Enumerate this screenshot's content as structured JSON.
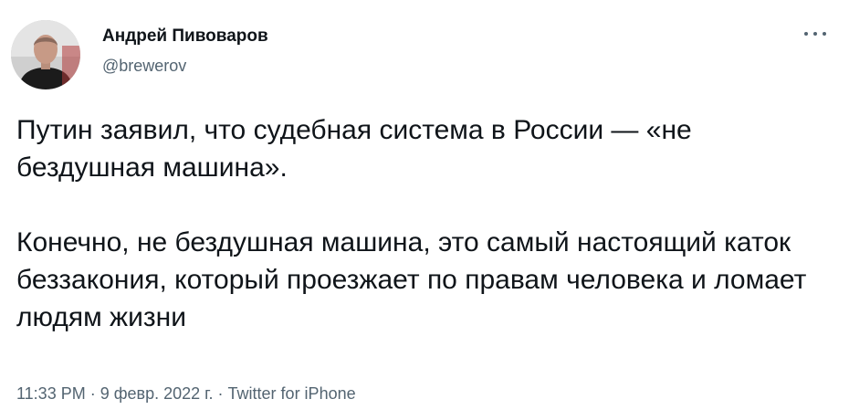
{
  "tweet": {
    "author": {
      "display_name": "Андрей Пивоваров",
      "handle": "@brewerov",
      "avatar": "profile-photo"
    },
    "more_icon": "more-horizontal-icon",
    "paragraphs": [
      "Путин заявил, что судебная система в России — «не бездушная машина».",
      "Конечно, не бездушная машина, это самый настоящий каток беззакония, который проезжает по правам человека и ломает людям жизни"
    ],
    "meta": {
      "time": "11:33 PM",
      "separator": " · ",
      "date": "9 февр. 2022 г.",
      "source": "Twitter for iPhone"
    }
  },
  "colors": {
    "text": "#0f1419",
    "secondary": "#536471",
    "background": "#ffffff"
  }
}
